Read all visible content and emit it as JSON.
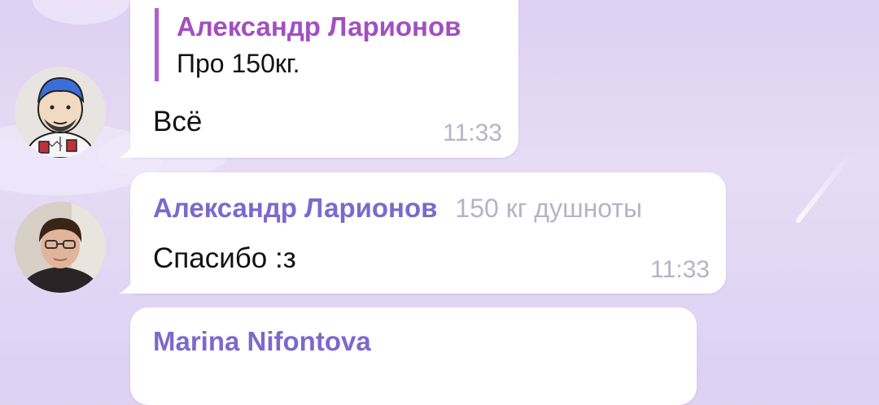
{
  "colors": {
    "background": "#e4daf4",
    "bubble": "#ffffff",
    "reply_accent": "#b25fc9",
    "reply_name": "#a24fc0",
    "sender_name": "#7b69cc",
    "meta_text": "#b7b2c6"
  },
  "messages": [
    {
      "avatar_icon": "user-avatar-cartoon",
      "reply": {
        "name": "Александр Ларионов",
        "text": "Про 150кг."
      },
      "text": "Всё",
      "time": "11:33"
    },
    {
      "avatar_icon": "user-avatar-photo",
      "sender": "Александр Ларионов",
      "rank": "150 кг душноты",
      "text": "Спасибо :з",
      "time": "11:33"
    },
    {
      "sender": "Marina Nifontova"
    }
  ]
}
